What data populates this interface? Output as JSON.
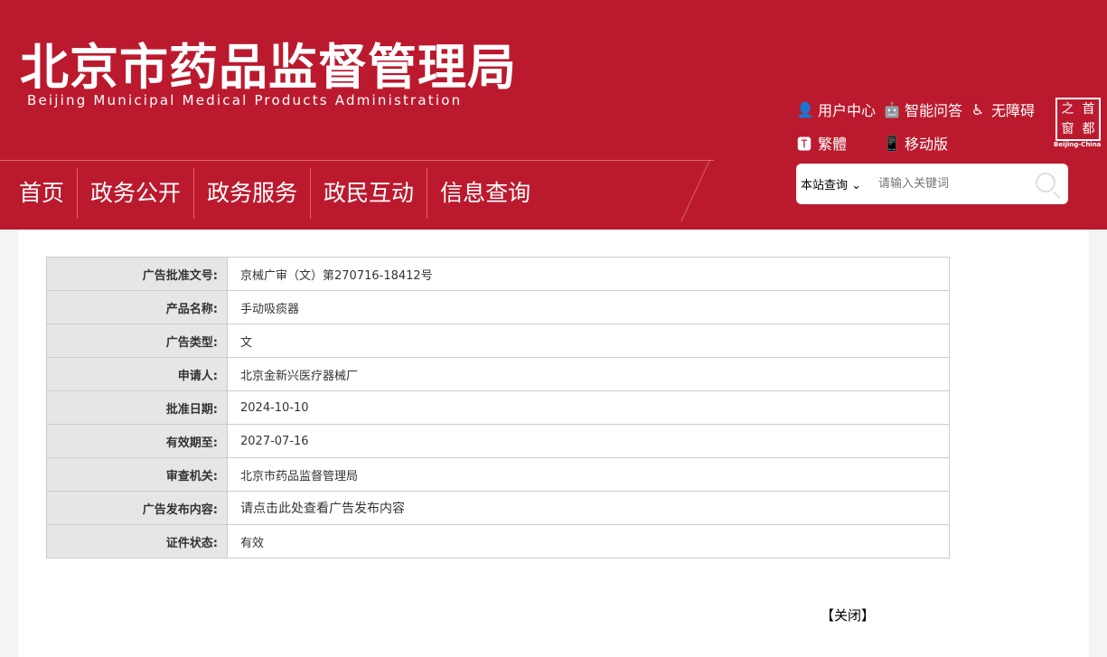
{
  "header": {
    "title_cn": "北京市药品监督管理局",
    "title_en": "Beijing Municipal Medical Products Administration",
    "nav": [
      "首页",
      "政务公开",
      "政务服务",
      "政民互动",
      "信息查询"
    ],
    "tools": {
      "user_center": "用户中心",
      "ai_qa": "智能问答",
      "accessibility": "无障碍",
      "traditional": "繁體",
      "mobile": "移动版"
    },
    "logo": {
      "chars": [
        "之",
        "首",
        "窗",
        "都"
      ],
      "en": "Beijing-China"
    },
    "search": {
      "scope": "本站查询",
      "placeholder": "请输入关键词"
    }
  },
  "table": [
    {
      "k": "广告批准文号:",
      "v": "京械广审（文）第270716-18412号"
    },
    {
      "k": "产品名称:",
      "v": "手动吸痰器"
    },
    {
      "k": "广告类型:",
      "v": "文"
    },
    {
      "k": "申请人:",
      "v": "北京金新兴医疗器械厂"
    },
    {
      "k": "批准日期:",
      "v": "2024-10-10"
    },
    {
      "k": "有效期至:",
      "v": "2027-07-16"
    },
    {
      "k": "审查机关:",
      "v": "北京市药品监督管理局"
    },
    {
      "k": "广告发布内容:",
      "v": "请点击此处查看广告发布内容"
    },
    {
      "k": "证件状态:",
      "v": "有效"
    }
  ],
  "close_label": "【关闭】"
}
